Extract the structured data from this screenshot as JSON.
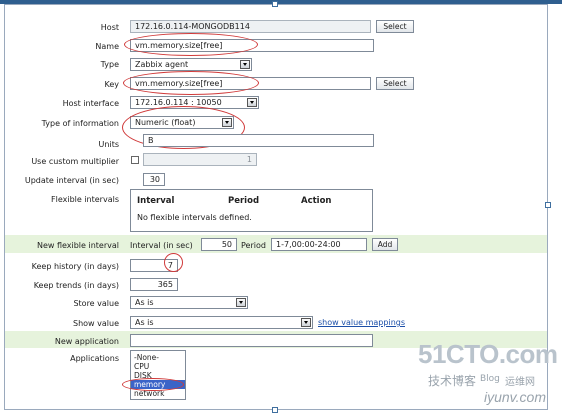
{
  "form": {
    "host": {
      "label": "Host",
      "value": "172.16.0.114-MONGODB114",
      "button": "Select"
    },
    "name": {
      "label": "Name",
      "value": "vm.memory.size[free]"
    },
    "type": {
      "label": "Type",
      "value": "Zabbix agent"
    },
    "key": {
      "label": "Key",
      "value": "vm.memory.size[free]",
      "button": "Select"
    },
    "host_interface": {
      "label": "Host interface",
      "value": "172.16.0.114 : 10050"
    },
    "type_of_information": {
      "label": "Type of information",
      "value": "Numeric (float)"
    },
    "units": {
      "label": "Units",
      "value": "B"
    },
    "custom_multiplier": {
      "label": "Use custom multiplier",
      "value": "1"
    },
    "update_interval": {
      "label": "Update interval (in sec)",
      "value": "30"
    },
    "flexible_intervals": {
      "label": "Flexible intervals",
      "columns": [
        "Interval",
        "Period",
        "Action"
      ],
      "empty_text": "No flexible intervals defined."
    },
    "new_flexible_interval": {
      "label": "New flexible interval",
      "interval_label": "Interval (in sec)",
      "interval_value": "50",
      "period_label": "Period",
      "period_value": "1-7,00:00-24:00",
      "add_button": "Add"
    },
    "keep_history": {
      "label": "Keep history (in days)",
      "value": "7"
    },
    "keep_trends": {
      "label": "Keep trends (in days)",
      "value": "365"
    },
    "store_value": {
      "label": "Store value",
      "value": "As is"
    },
    "show_value": {
      "label": "Show value",
      "value": "As is",
      "link": "show value mappings"
    },
    "new_application": {
      "label": "New application",
      "value": ""
    },
    "applications": {
      "label": "Applications",
      "options": [
        "-None-",
        "CPU",
        "DISK",
        "memory",
        "network"
      ],
      "selected": "memory"
    }
  },
  "watermark": {
    "logo": "51CTO.com",
    "tagline": "技术博客",
    "blog": "Blog",
    "site": "iyunv.com",
    "brand": "运维网"
  },
  "colors": {
    "highlight_oval": "#d03a3a",
    "band": "#e6f3dc",
    "selection": "#3a64c8",
    "link": "#1c4fa8"
  }
}
